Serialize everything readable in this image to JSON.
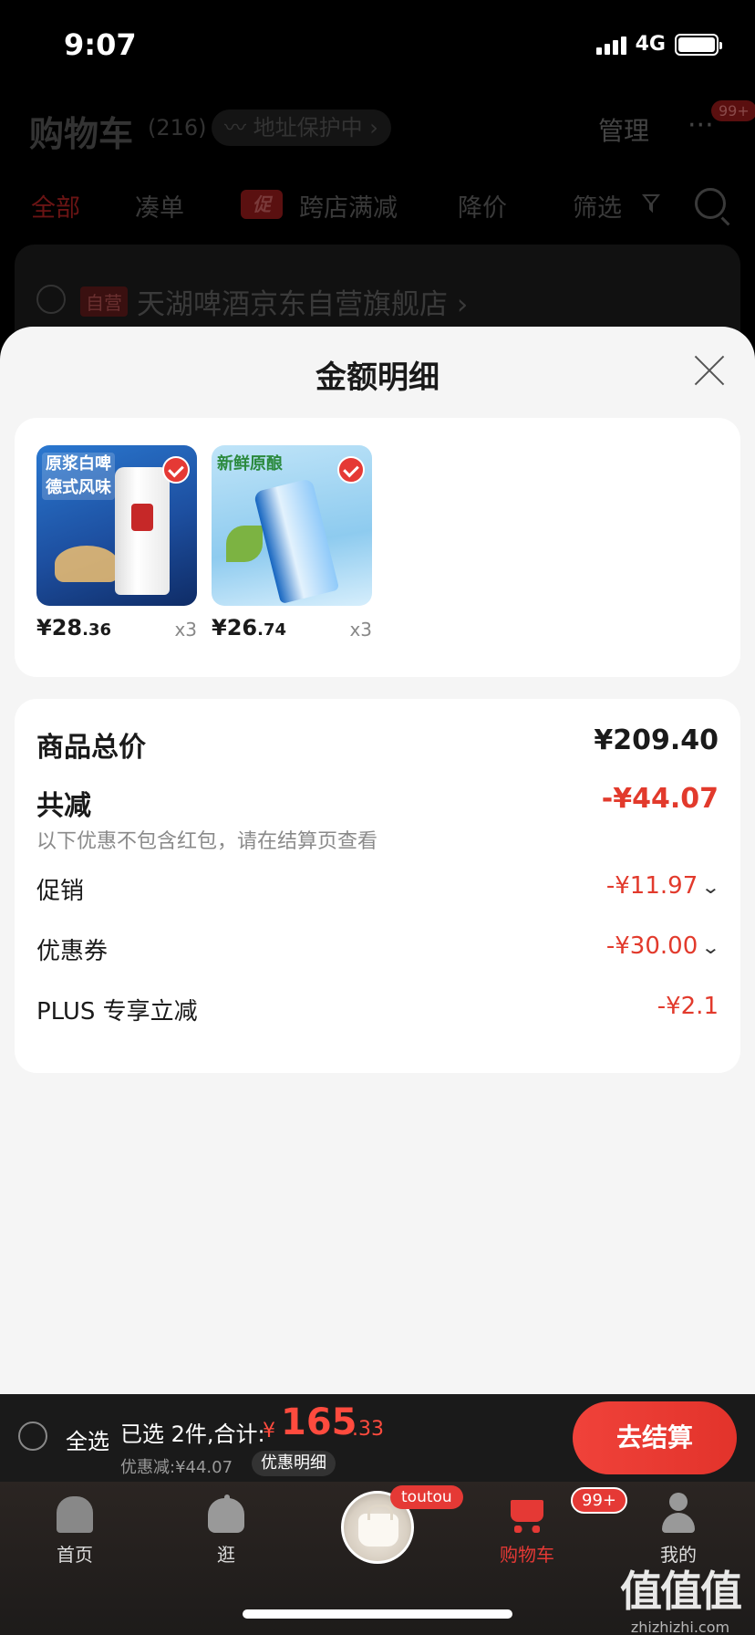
{
  "status_bar": {
    "time": "9:07",
    "network": "4G"
  },
  "cart_header": {
    "title": "购物车",
    "count": "(216)",
    "address_protect": "〰 地址保护中 ›",
    "manage": "管理",
    "more": "···",
    "more_badge": "99+"
  },
  "filter_tabs": {
    "all": "全部",
    "combine": "凑单",
    "promo_chip": "促",
    "cross_store": "跨店满减",
    "price_drop": "降价",
    "filter": "筛选"
  },
  "store": {
    "badge": "自营",
    "name": "天湖啤酒京东自营旗舰店 ›"
  },
  "sheet": {
    "title": "金额明细",
    "products": [
      {
        "banner": "原浆白啤\n德式风味",
        "price_int": "¥28",
        "price_cents": ".36",
        "qty": "x3"
      },
      {
        "banner": "新鲜原酿",
        "price_int": "¥26",
        "price_cents": ".74",
        "qty": "x3"
      }
    ],
    "summary": {
      "subtotal_label": "商品总价",
      "subtotal_value": "¥209.40",
      "total_off_label": "共减",
      "total_off_value": "-¥44.07",
      "note": "以下优惠不包含红包，请在结算页查看",
      "promo_label": "促销",
      "promo_value": "-¥11.97",
      "coupon_label": "优惠券",
      "coupon_value": "-¥30.00",
      "plus_label": "PLUS 专享立减",
      "plus_value": "-¥2.1",
      "chevron": "⌄"
    }
  },
  "checkout": {
    "select_all": "全选",
    "selected_text": "已选 2件,合计:",
    "yen": "¥",
    "total_int": "165",
    "total_cents": ".33",
    "discount_text": "优惠减:¥44.07",
    "detail_button": "优惠明细",
    "checkout_button": "去结算"
  },
  "tab_bar": {
    "home": "首页",
    "explore": "逛",
    "center_tag": "toutou",
    "cart": "购物车",
    "cart_badge": "99+",
    "me": "我的"
  },
  "watermark": {
    "glyph": "值值值",
    "text": "zhizhizhi.com"
  },
  "colors": {
    "accent_red": "#e23a2c",
    "sheet_bg": "#f5f5f5",
    "card_bg": "#ffffff",
    "bar_bg": "#1a1a1a"
  }
}
